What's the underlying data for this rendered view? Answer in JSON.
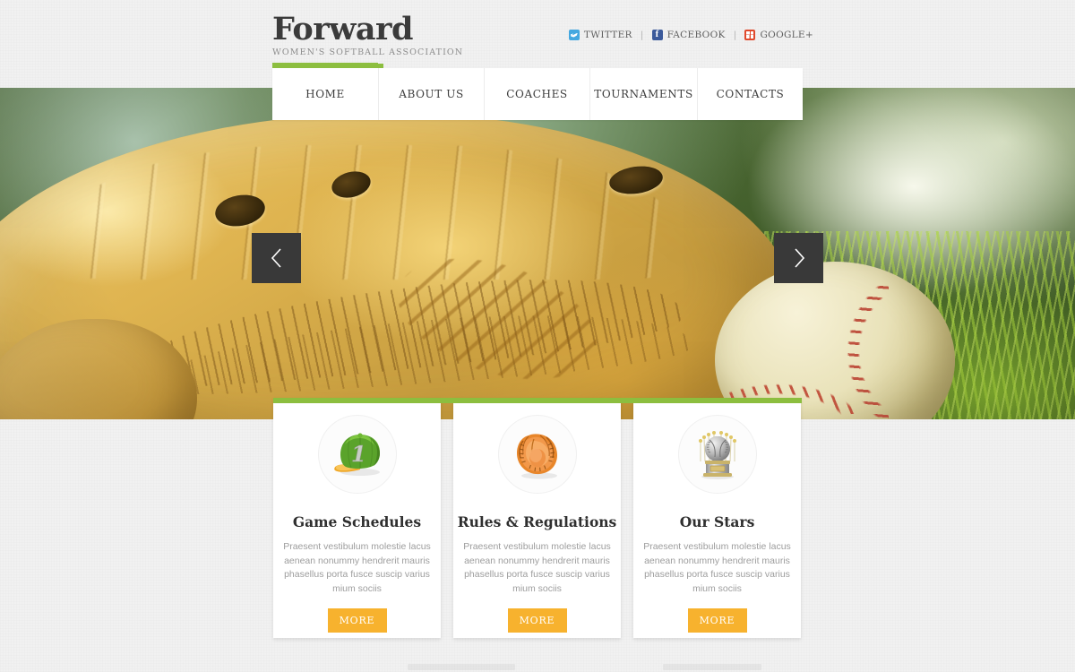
{
  "header": {
    "logo_title": "Forward",
    "logo_tagline": "WOMEN'S SOFTBALL ASSOCIATION",
    "social": [
      {
        "label": "TWITTER",
        "icon": "twitter-icon"
      },
      {
        "label": "FACEBOOK",
        "icon": "facebook-icon"
      },
      {
        "label": "GOOGLE+",
        "icon": "google-plus-icon"
      }
    ],
    "separator": "|"
  },
  "nav": {
    "items": [
      {
        "label": "HOME",
        "active": true
      },
      {
        "label": "ABOUT US",
        "active": false
      },
      {
        "label": "COACHES",
        "active": false
      },
      {
        "label": "TOURNAMENTS",
        "active": false
      },
      {
        "label": "CONTACTS",
        "active": false
      }
    ]
  },
  "hero": {
    "description": "Close-up photo of a golden leather baseball glove and a worn baseball in green grass",
    "prev_label": "‹",
    "next_label": "›"
  },
  "cards": [
    {
      "icon": "baseball-cap-icon",
      "title": "Game Schedules",
      "text": "Praesent vestibulum molestie lacus aenean nonummy hendrerit mauris phasellus porta fusce suscip varius mium sociis",
      "button": "MORE"
    },
    {
      "icon": "baseball-glove-icon",
      "title": "Rules & Regulations",
      "text": "Praesent vestibulum molestie lacus aenean nonummy hendrerit mauris phasellus porta fusce suscip varius mium sociis",
      "button": "MORE"
    },
    {
      "icon": "trophy-icon",
      "title": "Our Stars",
      "text": "Praesent vestibulum molestie lacus aenean nonummy hendrerit mauris phasellus porta fusce suscip varius mium sociis",
      "button": "MORE"
    }
  ],
  "colors": {
    "accent_green": "#8cbe3f",
    "accent_orange": "#f7b22e",
    "page_bg": "#f1f1f1",
    "dark": "#393939"
  }
}
